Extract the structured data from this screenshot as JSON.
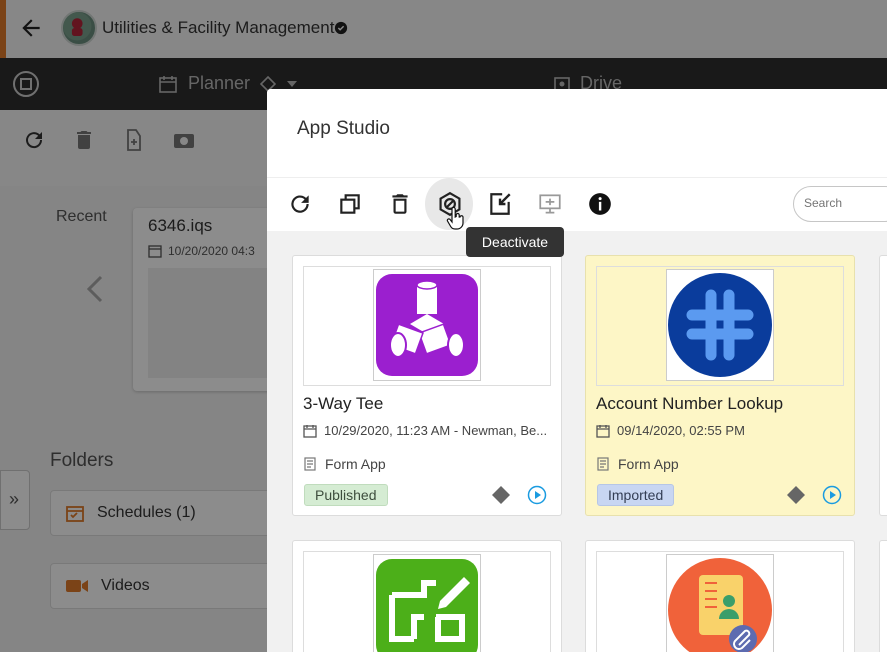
{
  "appbar": {
    "title": "Utilities & Facility Management"
  },
  "navbar": {
    "planner_label": "Planner",
    "drive_label": "Drive"
  },
  "background": {
    "recent_label": "Recent",
    "recent_file": {
      "name": "6346.iqs",
      "date": "10/20/2020 04:3"
    },
    "folders_label": "Folders",
    "folders": [
      {
        "label": "Schedules (1)"
      },
      {
        "label": "Videos"
      }
    ],
    "expand_glyph": "»"
  },
  "dialog": {
    "title": "App Studio",
    "toolbar": {
      "icons": [
        "refresh-icon",
        "copy-icon",
        "delete-icon",
        "deactivate-icon",
        "import-icon",
        "publish-icon",
        "info-icon"
      ],
      "hovered": "deactivate-icon"
    },
    "search": {
      "placeholder": "Search"
    },
    "tooltip": "Deactivate",
    "cards": [
      {
        "name": "3-Way Tee",
        "meta": "10/29/2020, 11:23 AM - Newman, Be...",
        "type": "Form App",
        "status": "Published",
        "icon": "pipe-tee-icon",
        "icon_color": "#9b1fcf",
        "highlighted": false
      },
      {
        "name": "Account Number Lookup",
        "meta": "09/14/2020, 02:55 PM",
        "type": "Form App",
        "status": "Imported",
        "icon": "hashtag-icon",
        "icon_color": "#0a3c9c",
        "highlighted": true
      },
      {
        "icon": "floorplan-edit-icon",
        "icon_color": "#4caf19"
      },
      {
        "icon": "contact-book-icon",
        "icon_color": "#f0623a"
      }
    ]
  },
  "colors": {
    "accent": "#e07b2a",
    "link_blue": "#1a9be0",
    "published_bg": "#d5ecd3",
    "imported_bg": "#c8d6f2",
    "highlight_bg": "#fdf6c6"
  }
}
